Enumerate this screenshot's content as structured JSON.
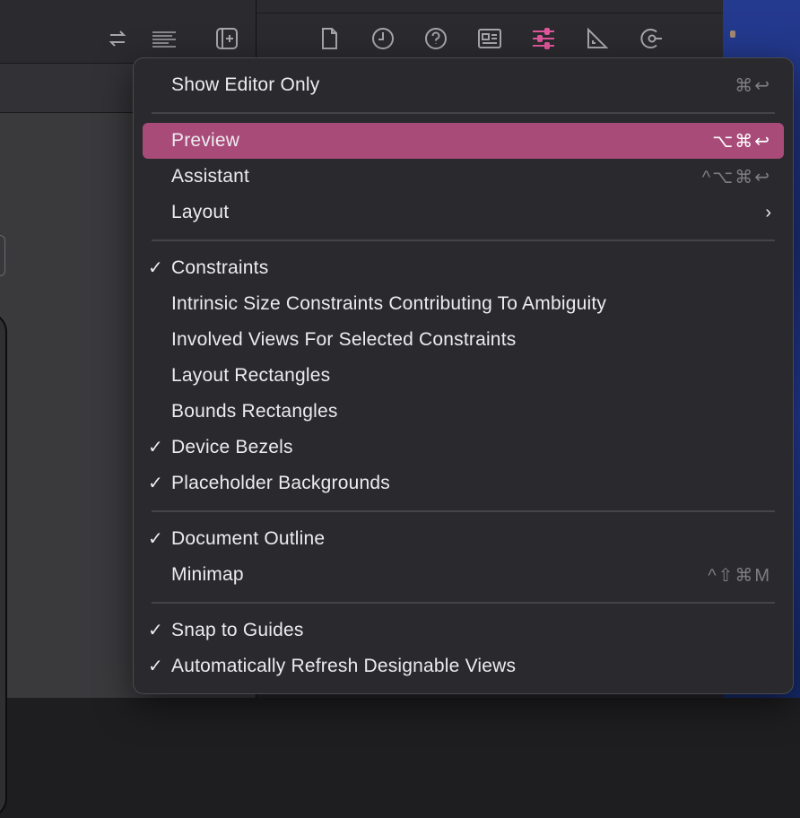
{
  "toolbar": {
    "left_icons": [
      "swap-arrows-icon",
      "text-align-icon",
      "add-editor-icon"
    ],
    "right_icons": [
      "file-icon",
      "history-icon",
      "help-icon",
      "identity-card-icon",
      "attributes-sliders-icon",
      "size-ruler-icon",
      "connections-icon"
    ],
    "active_icon": "attributes-sliders-icon",
    "accent": "#e0569b"
  },
  "menu": {
    "highlight_color": "#a94b79",
    "items": [
      {
        "label": "Show Editor Only",
        "shortcut": "⌘↩",
        "checked": false
      },
      {
        "label": "Preview",
        "shortcut": "⌥⌘↩",
        "checked": false,
        "highlighted": true
      },
      {
        "label": "Assistant",
        "shortcut": "^⌥⌘↩",
        "checked": false
      },
      {
        "label": "Layout",
        "submenu": true,
        "checked": false
      },
      {
        "label": "Constraints",
        "checked": true
      },
      {
        "label": "Intrinsic Size Constraints Contributing To Ambiguity",
        "checked": false
      },
      {
        "label": "Involved Views For Selected Constraints",
        "checked": false
      },
      {
        "label": "Layout Rectangles",
        "checked": false
      },
      {
        "label": "Bounds Rectangles",
        "checked": false
      },
      {
        "label": "Device Bezels",
        "checked": true
      },
      {
        "label": "Placeholder Backgrounds",
        "checked": true
      },
      {
        "label": "Document Outline",
        "checked": true
      },
      {
        "label": "Minimap",
        "shortcut": "^⇧⌘M",
        "checked": false
      },
      {
        "label": "Snap to Guides",
        "checked": true
      },
      {
        "label": "Automatically Refresh Designable Views",
        "checked": true
      }
    ],
    "check_glyph": "✓",
    "submenu_glyph": "›"
  }
}
